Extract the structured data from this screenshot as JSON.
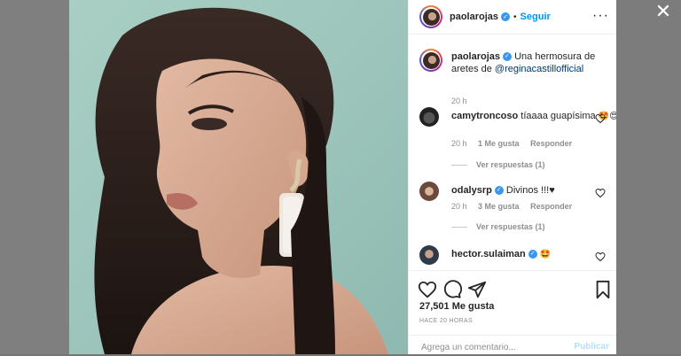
{
  "modal": {
    "close_icon": "close-icon"
  },
  "post": {
    "username": "paolarojas",
    "follow_label": "Seguir",
    "more_icon": "more-options-icon"
  },
  "caption": {
    "username": "paolarojas",
    "text": "Una hermosura de aretes de ",
    "mention": "@reginacastillofficial",
    "time": "20 h"
  },
  "comments": [
    {
      "username": "camytroncoso",
      "text": "tíaaaa guapísima",
      "emoji": "🤩😍🙈",
      "time": "20 h",
      "likes": "1 Me gusta",
      "reply": "Responder",
      "view_replies": "Ver respuestas (1)",
      "verified": false
    },
    {
      "username": "odalysrp",
      "text": "Divinos !!!♥",
      "emoji": "",
      "time": "20 h",
      "likes": "3 Me gusta",
      "reply": "Responder",
      "view_replies": "Ver respuestas (1)",
      "verified": true
    },
    {
      "username": "hector.sulaiman",
      "text": "",
      "emoji": "🤩",
      "time": "",
      "likes": "",
      "reply": "",
      "view_replies": "",
      "verified": true
    }
  ],
  "actions": {
    "icons": [
      "heart-icon",
      "comment-icon",
      "share-icon",
      "bookmark-icon"
    ],
    "likes_count": "27,501",
    "likes_suffix": " Me gusta",
    "posted": "HACE 20 HORAS"
  },
  "comment_box": {
    "placeholder": "Agrega un comentario...",
    "publish_label": "Publicar"
  },
  "colors": {
    "link": "#0095f6",
    "mention": "#00376b",
    "muted": "#8e8e8e",
    "photo_bg": "#a9cfc4"
  }
}
